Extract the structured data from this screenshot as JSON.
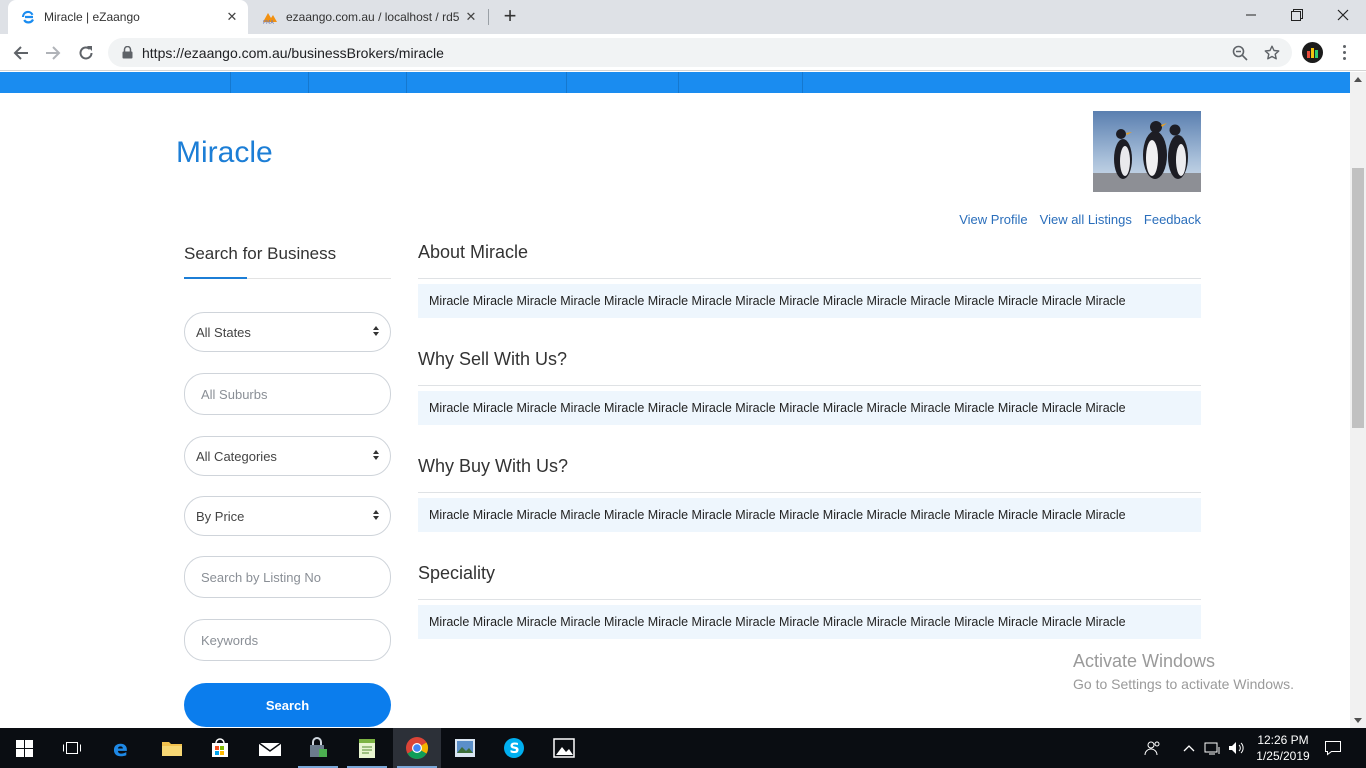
{
  "browser": {
    "tabs": [
      {
        "title": "Miracle | eZaango",
        "active": true
      },
      {
        "title": "ezaango.com.au / localhost / rd5",
        "active": false
      }
    ],
    "url": "https://ezaango.com.au/businessBrokers/miracle"
  },
  "page": {
    "title": "Miracle",
    "profile_links": [
      "View Profile",
      "View all Listings",
      "Feedback"
    ],
    "sidebar": {
      "title": "Search for Business",
      "state_select": "All States",
      "suburb_placeholder": "All Suburbs",
      "category_select": "All Categories",
      "price_select": "By Price",
      "listing_placeholder": "Search by Listing No",
      "keywords_placeholder": "Keywords",
      "search_button": "Search"
    },
    "sections": [
      {
        "heading": "About Miracle",
        "text": "Miracle Miracle Miracle Miracle Miracle Miracle Miracle Miracle Miracle Miracle Miracle Miracle Miracle Miracle Miracle Miracle"
      },
      {
        "heading": "Why Sell With Us?",
        "text": "Miracle Miracle Miracle Miracle Miracle Miracle Miracle Miracle Miracle Miracle Miracle Miracle Miracle Miracle Miracle Miracle"
      },
      {
        "heading": "Why Buy With Us?",
        "text": "Miracle Miracle Miracle Miracle Miracle Miracle Miracle Miracle Miracle Miracle Miracle Miracle Miracle Miracle Miracle Miracle"
      },
      {
        "heading": "Speciality",
        "text": "Miracle Miracle Miracle Miracle Miracle Miracle Miracle Miracle Miracle Miracle Miracle Miracle Miracle Miracle Miracle Miracle"
      }
    ]
  },
  "watermark": {
    "line1": "Activate Windows",
    "line2": "Go to Settings to activate Windows."
  },
  "taskbar": {
    "time": "12:26 PM",
    "date": "1/25/2019",
    "icons": [
      "windows-start-icon",
      "task-view-icon",
      "edge-icon",
      "file-explorer-icon",
      "store-icon",
      "mail-icon",
      "security-icon",
      "notepad-icon",
      "chrome-icon",
      "photos-viewer-icon",
      "skype-icon",
      "photos-icon"
    ]
  },
  "colors": {
    "accent": "#1c7ed6",
    "navbar": "#1a8cf0",
    "search_button": "#0b7ded",
    "content_box": "#eef6fd"
  }
}
